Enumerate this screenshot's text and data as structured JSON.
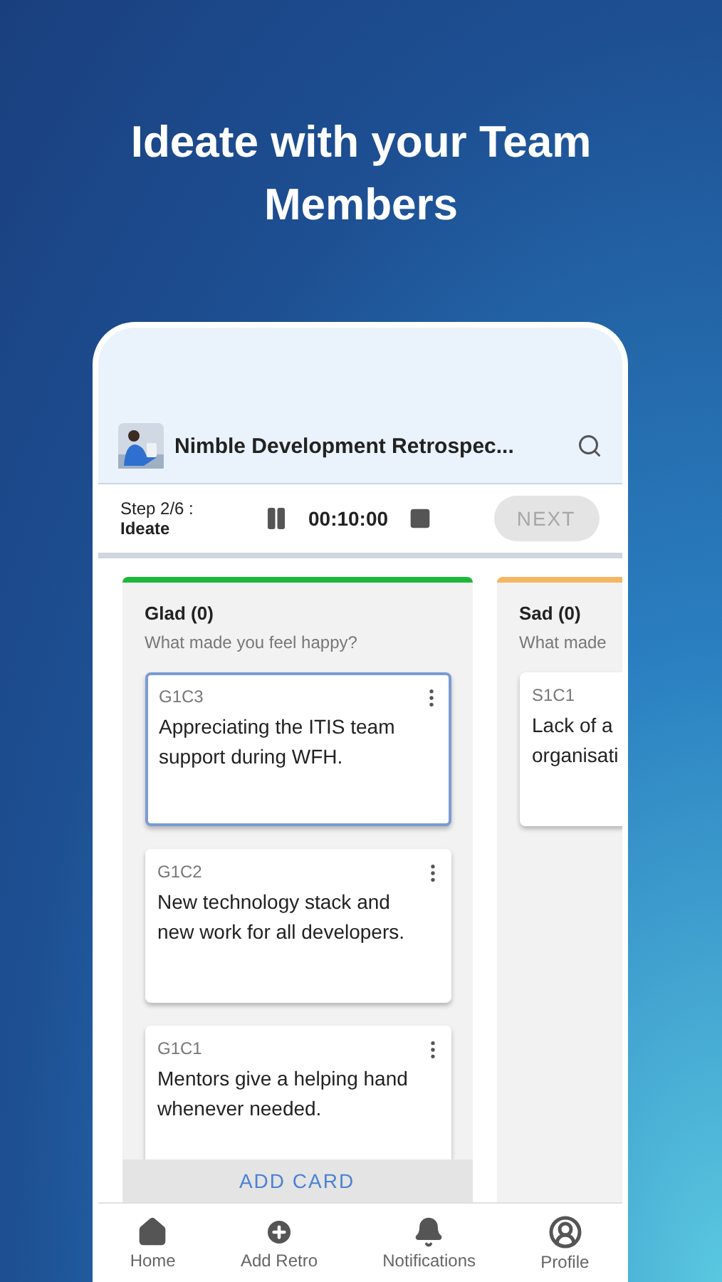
{
  "headline": "Ideate with your Team Members",
  "header": {
    "title": "Nimble Development Retrospec..."
  },
  "step_bar": {
    "step": "Step 2/6 :",
    "stage": "Ideate",
    "timer": "00:10:00",
    "next_button": "NEXT",
    "next_disabled": true
  },
  "columns": [
    {
      "title": "Glad (0)",
      "subtitle": "What made you feel happy?",
      "color": "#1db83a",
      "add_button": "ADD CARD",
      "cards": [
        {
          "code": "G1C3",
          "text": "Appreciating the ITIS team support during WFH.",
          "selected": true,
          "menu": true
        },
        {
          "code": "G1C2",
          "text": "New technology stack and new work for all developers.",
          "selected": false,
          "menu": true
        },
        {
          "code": "G1C1",
          "text": "Mentors give a helping hand whenever needed.",
          "selected": false,
          "menu": true
        }
      ]
    },
    {
      "title": "Sad (0)",
      "subtitle": "What made",
      "color": "#f5b663",
      "cards": [
        {
          "code": "S1C1",
          "text": "Lack of a\norganisati",
          "selected": false
        }
      ]
    }
  ],
  "bottom_nav": [
    {
      "kind": "home",
      "label": "Home"
    },
    {
      "kind": "add",
      "label": "Add Retro"
    },
    {
      "kind": "bell",
      "label": "Notifications"
    },
    {
      "kind": "profile",
      "label": "Profile"
    }
  ]
}
